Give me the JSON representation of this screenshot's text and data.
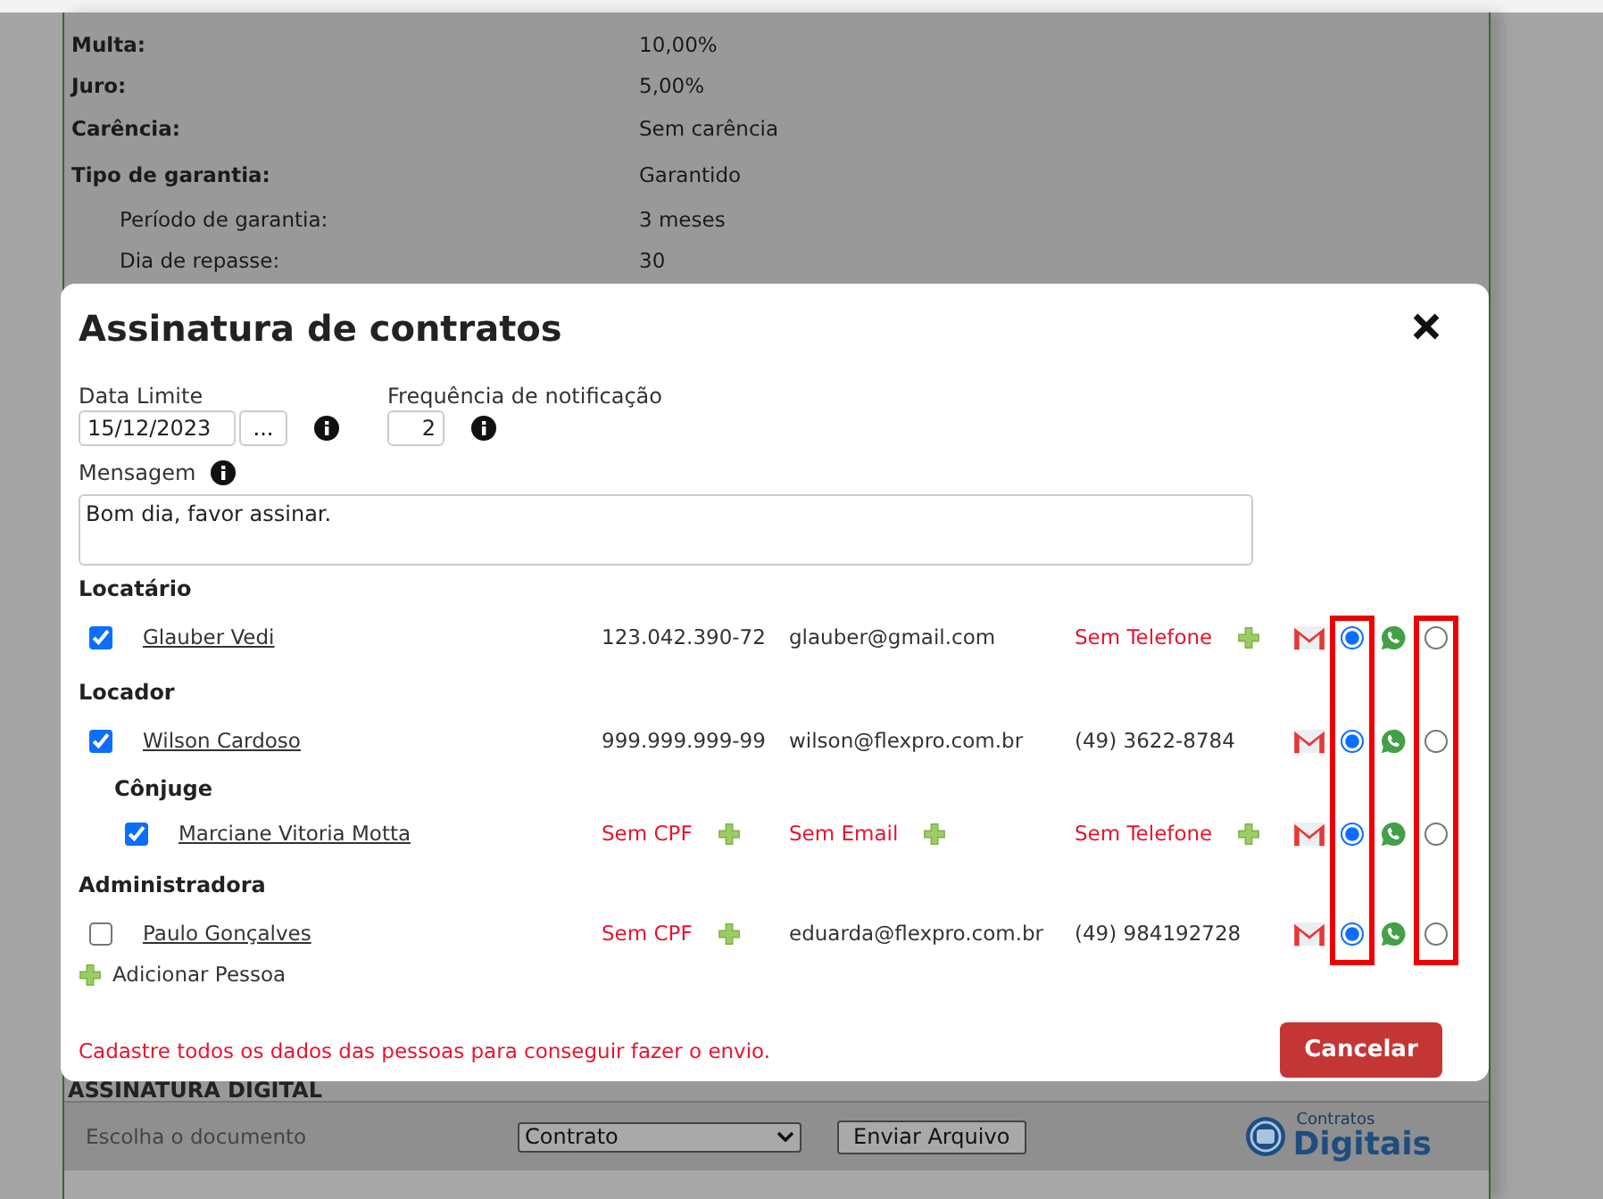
{
  "page": {
    "fields": [
      {
        "label": "Multa:",
        "value": "10,00%",
        "indented": false
      },
      {
        "label": "Juro:",
        "value": "5,00%",
        "indented": false
      },
      {
        "label": "Carência:",
        "value": "Sem carência",
        "indented": false
      },
      {
        "label": "Tipo de garantia:",
        "value": "Garantido",
        "indented": false
      },
      {
        "label": "Período de garantia:",
        "value": "3 meses",
        "indented": true
      },
      {
        "label": "Dia de repasse:",
        "value": "30",
        "indented": true
      }
    ],
    "section_title": "ASSINATURA DIGITAL",
    "document_label": "Escolha o documento",
    "document_select": "Contrato",
    "send_button": "Enviar Arquivo",
    "logo": {
      "small": "Contratos",
      "big": "Digitais"
    }
  },
  "modal": {
    "title": "Assinatura de contratos",
    "deadline": {
      "label": "Data Limite",
      "value": "15/12/2023",
      "picker": "..."
    },
    "frequency": {
      "label": "Frequência de notificação",
      "value": "2"
    },
    "message": {
      "label": "Mensagem",
      "value": "Bom dia, favor assinar."
    },
    "groups": [
      {
        "title": "Locatário",
        "people": [
          {
            "name": "Glauber Vedi",
            "checked": true,
            "cpf": {
              "text": "123.042.390-72",
              "missing": false
            },
            "email": {
              "text": "glauber@gmail.com",
              "missing": false
            },
            "phone": {
              "text": "Sem Telefone",
              "missing": true
            },
            "email_selected": true,
            "whatsapp_selected": false
          }
        ]
      },
      {
        "title": "Locador",
        "people": [
          {
            "name": "Wilson Cardoso",
            "checked": true,
            "cpf": {
              "text": "999.999.999-99",
              "missing": false
            },
            "email": {
              "text": "wilson@flexpro.com.br",
              "missing": false
            },
            "phone": {
              "text": "(49) 3622-8784",
              "missing": false
            },
            "email_selected": true,
            "whatsapp_selected": false
          }
        ],
        "children": [
          {
            "title": "Cônjuge",
            "people": [
              {
                "name": "Marciane Vitoria Motta",
                "checked": true,
                "cpf": {
                  "text": "Sem CPF",
                  "missing": true
                },
                "email": {
                  "text": "Sem Email",
                  "missing": true
                },
                "phone": {
                  "text": "Sem Telefone",
                  "missing": true
                },
                "email_selected": true,
                "whatsapp_selected": false
              }
            ]
          }
        ]
      },
      {
        "title": "Administradora",
        "people": [
          {
            "name": "Paulo Gonçalves",
            "checked": false,
            "cpf": {
              "text": "Sem CPF",
              "missing": true
            },
            "email": {
              "text": "eduarda@flexpro.com.br",
              "missing": false
            },
            "phone": {
              "text": "(49) 984192728",
              "missing": false
            },
            "email_selected": true,
            "whatsapp_selected": false
          }
        ]
      }
    ],
    "add_person": "Adicionar Pessoa",
    "warning": "Cadastre todos os dados das pessoas para conseguir fazer o envio.",
    "cancel_button": "Cancelar"
  }
}
